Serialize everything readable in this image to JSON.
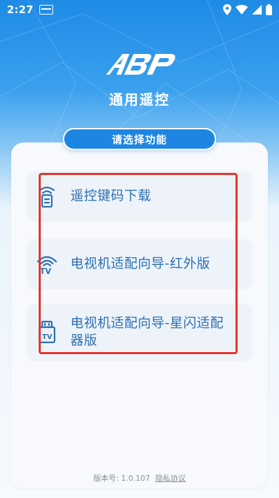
{
  "status_bar": {
    "time": "2:27",
    "icons": [
      "notification-icon",
      "location-icon",
      "wifi-icon",
      "signal-icon",
      "battery-icon"
    ]
  },
  "header": {
    "logo_text": "ABP",
    "title": "通用遥控"
  },
  "section": {
    "title": "请选择功能"
  },
  "menu": {
    "items": [
      {
        "label": "遥控键码下载",
        "icon": "remote-wifi-icon"
      },
      {
        "label": "电视机适配向导-红外版",
        "icon": "tv-infrared-icon"
      },
      {
        "label": "电视机适配向导-星闪适配器版",
        "icon": "tv-adapter-icon"
      }
    ]
  },
  "footer": {
    "version": "版本号: 1.0.107",
    "privacy_link": "隐私协议"
  },
  "colors": {
    "header_blue": "#1f8be6",
    "pill_blue": "#1e86e2",
    "item_text": "#2b6fb3",
    "highlight_red": "#e5332a"
  }
}
